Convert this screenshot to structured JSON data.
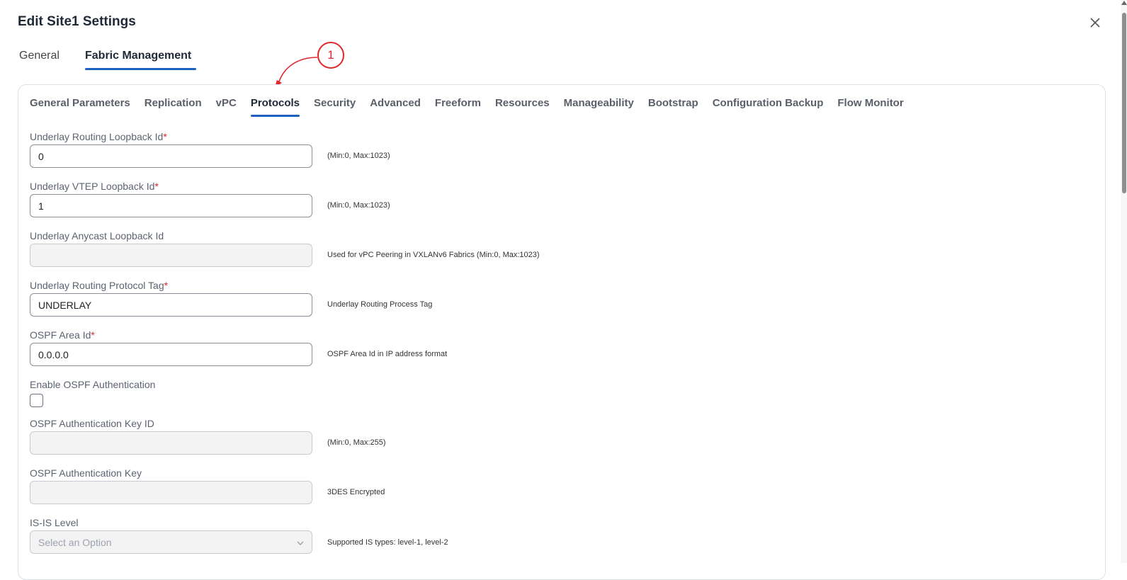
{
  "dialog": {
    "title": "Edit Site1 Settings"
  },
  "main_tabs": [
    {
      "label": "General"
    },
    {
      "label": "Fabric Management"
    }
  ],
  "callout": {
    "number": "1"
  },
  "sub_tabs": [
    {
      "label": "General Parameters"
    },
    {
      "label": "Replication"
    },
    {
      "label": "vPC"
    },
    {
      "label": "Protocols"
    },
    {
      "label": "Security"
    },
    {
      "label": "Advanced"
    },
    {
      "label": "Freeform"
    },
    {
      "label": "Resources"
    },
    {
      "label": "Manageability"
    },
    {
      "label": "Bootstrap"
    },
    {
      "label": "Configuration Backup"
    },
    {
      "label": "Flow Monitor"
    }
  ],
  "active_sub_tab": "Protocols",
  "required_marker": "*",
  "fields": {
    "routing_loopback": {
      "label": "Underlay Routing Loopback Id",
      "value": "0",
      "help": "(Min:0, Max:1023)"
    },
    "vtep_loopback": {
      "label": "Underlay VTEP Loopback Id",
      "value": "1",
      "help": "(Min:0, Max:1023)"
    },
    "anycast_loopback": {
      "label": "Underlay Anycast Loopback Id",
      "value": "",
      "help": "Used for vPC Peering in VXLANv6 Fabrics (Min:0, Max:1023)"
    },
    "routing_protocol_tag": {
      "label": "Underlay Routing Protocol Tag",
      "value": "UNDERLAY",
      "help": "Underlay Routing Process Tag"
    },
    "ospf_area_id": {
      "label": "OSPF Area Id",
      "value": "0.0.0.0",
      "help": "OSPF Area Id in IP address format"
    },
    "enable_ospf_auth": {
      "label": "Enable OSPF Authentication",
      "checked": false
    },
    "ospf_auth_key_id": {
      "label": "OSPF Authentication Key ID",
      "value": "",
      "help": "(Min:0, Max:255)"
    },
    "ospf_auth_key": {
      "label": "OSPF Authentication Key",
      "value": "",
      "help": "3DES Encrypted"
    },
    "isis_level": {
      "label": "IS-IS Level",
      "placeholder": "Select an Option",
      "help": "Supported IS types: level-1, level-2"
    }
  },
  "colors": {
    "accent": "#1f5fbf",
    "required": "#e0272c",
    "callout": "#e0272c"
  }
}
